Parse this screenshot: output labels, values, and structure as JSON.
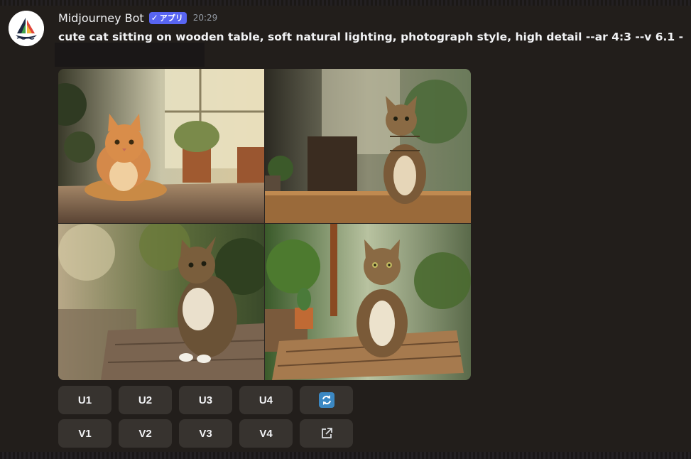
{
  "message": {
    "username": "Midjourney Bot",
    "badge": {
      "check": "✓",
      "label": "アプリ"
    },
    "timestamp": "20:29",
    "prompt": "cute cat sitting on wooden table, soft natural lighting, photograph style, high detail --ar 4:3 --v 6.1 -"
  },
  "image_grid": {
    "tiles": [
      {
        "name": "orange cat lying on table, sunlit window"
      },
      {
        "name": "tabby cat sitting, cafe background"
      },
      {
        "name": "tabby cat looking up, garden background"
      },
      {
        "name": "tabby cat sitting beside cactus pot"
      }
    ]
  },
  "buttons": {
    "upscale": [
      "U1",
      "U2",
      "U3",
      "U4"
    ],
    "variation": [
      "V1",
      "V2",
      "V3",
      "V4"
    ],
    "reroll_icon": "refresh-icon",
    "web_icon": "external-link-icon"
  },
  "colors": {
    "background": "#221e1b",
    "button": "#37332f",
    "badge": "#5865f2",
    "reroll": "#3b88c3"
  }
}
